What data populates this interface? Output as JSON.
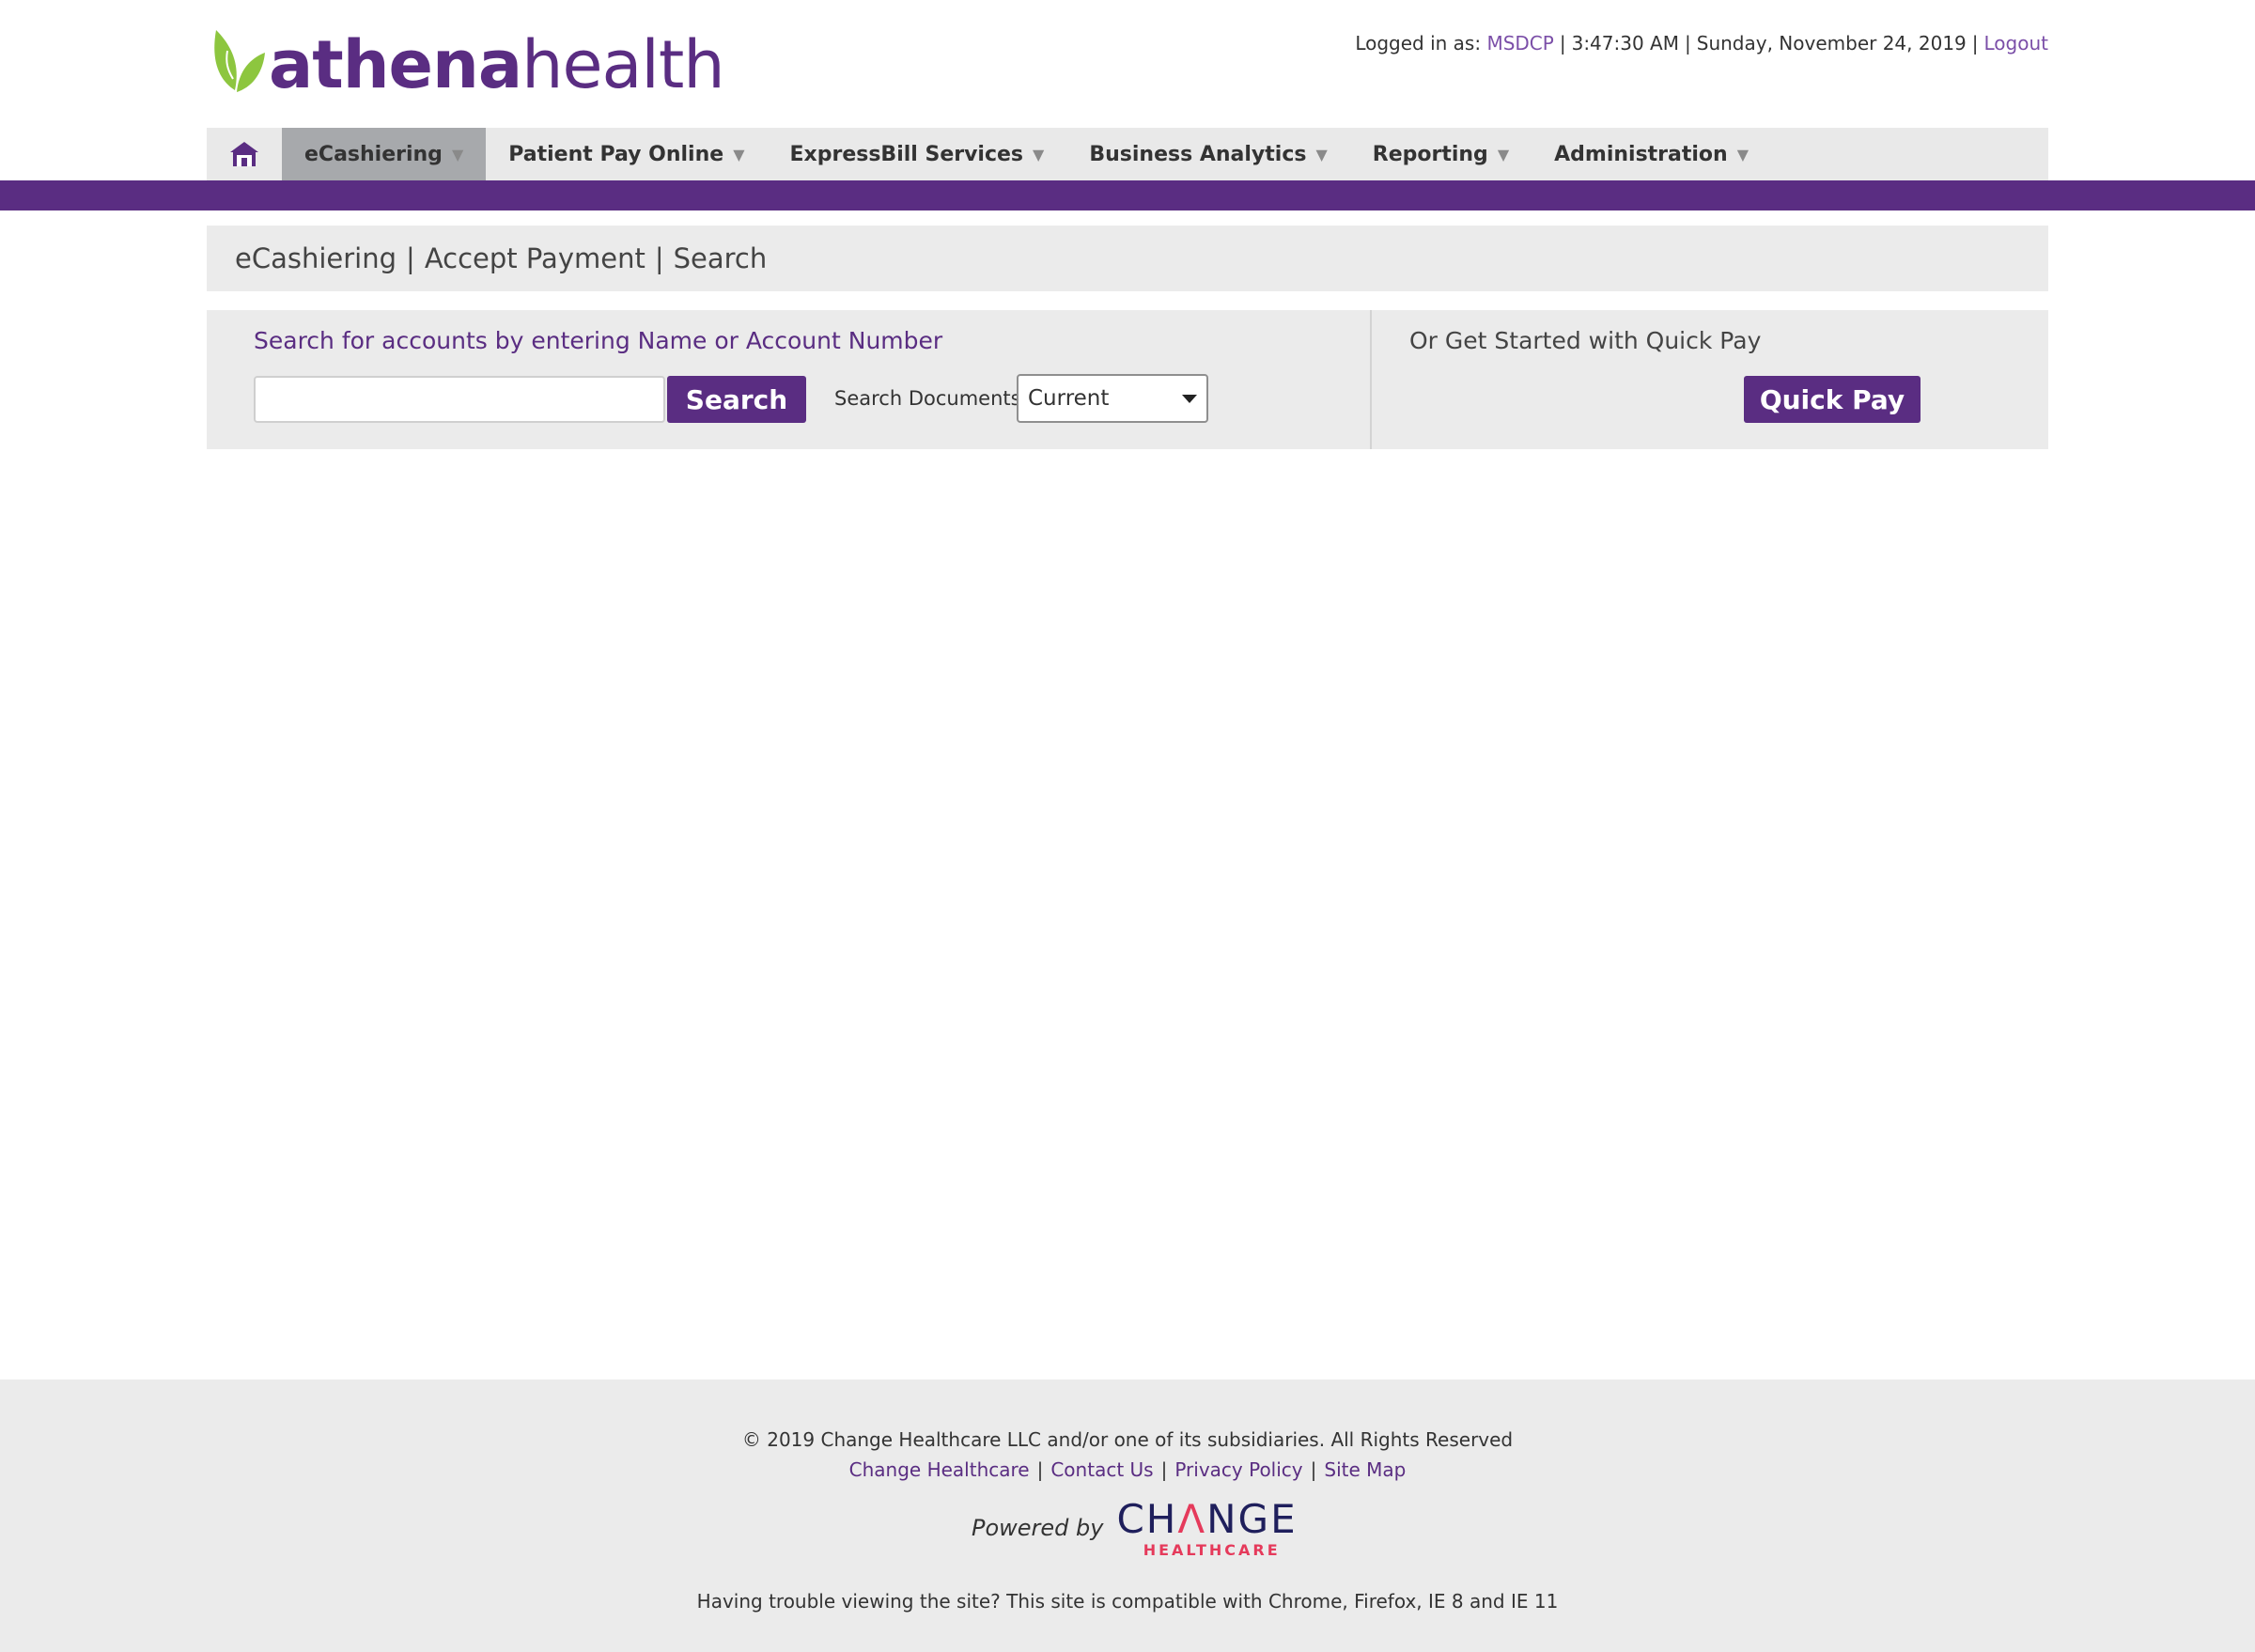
{
  "brand": {
    "athena": "athena",
    "health": "health",
    "leaf_color": "#8dc63f",
    "primary_color": "#5a2d82"
  },
  "userinfo": {
    "logged_in_label": "Logged in as:",
    "username": "MSDCP",
    "time": "3:47:30 AM",
    "date": "Sunday, November 24, 2019",
    "logout": "Logout"
  },
  "nav": {
    "home_icon": "home-icon",
    "items": [
      {
        "label": "eCashiering",
        "active": true
      },
      {
        "label": "Patient Pay Online"
      },
      {
        "label": "ExpressBill Services"
      },
      {
        "label": "Business Analytics"
      },
      {
        "label": "Reporting"
      },
      {
        "label": "Administration"
      }
    ]
  },
  "breadcrumb": {
    "items": [
      "eCashiering",
      "Accept Payment",
      "Search"
    ],
    "separator": "|"
  },
  "search": {
    "heading": "Search for accounts by entering Name or Account Number",
    "input_value": "",
    "button": "Search",
    "docs_label": "Search Documents",
    "docs_selected": "Current"
  },
  "quickpay": {
    "heading": "Or Get Started with Quick Pay",
    "button": "Quick Pay"
  },
  "footer": {
    "copyright": "© 2019 Change Healthcare LLC and/or one of its subsidiaries. All Rights Reserved",
    "links": [
      "Change Healthcare",
      "Contact Us",
      "Privacy Policy",
      "Site Map"
    ],
    "powered_by": "Powered by",
    "change_pre": "CH",
    "change_a": "Λ",
    "change_post": "NGE",
    "healthcare": "HEALTHCARE",
    "compat": "Having trouble viewing the site? This site is compatible with Chrome, Firefox, IE 8 and IE 11"
  }
}
